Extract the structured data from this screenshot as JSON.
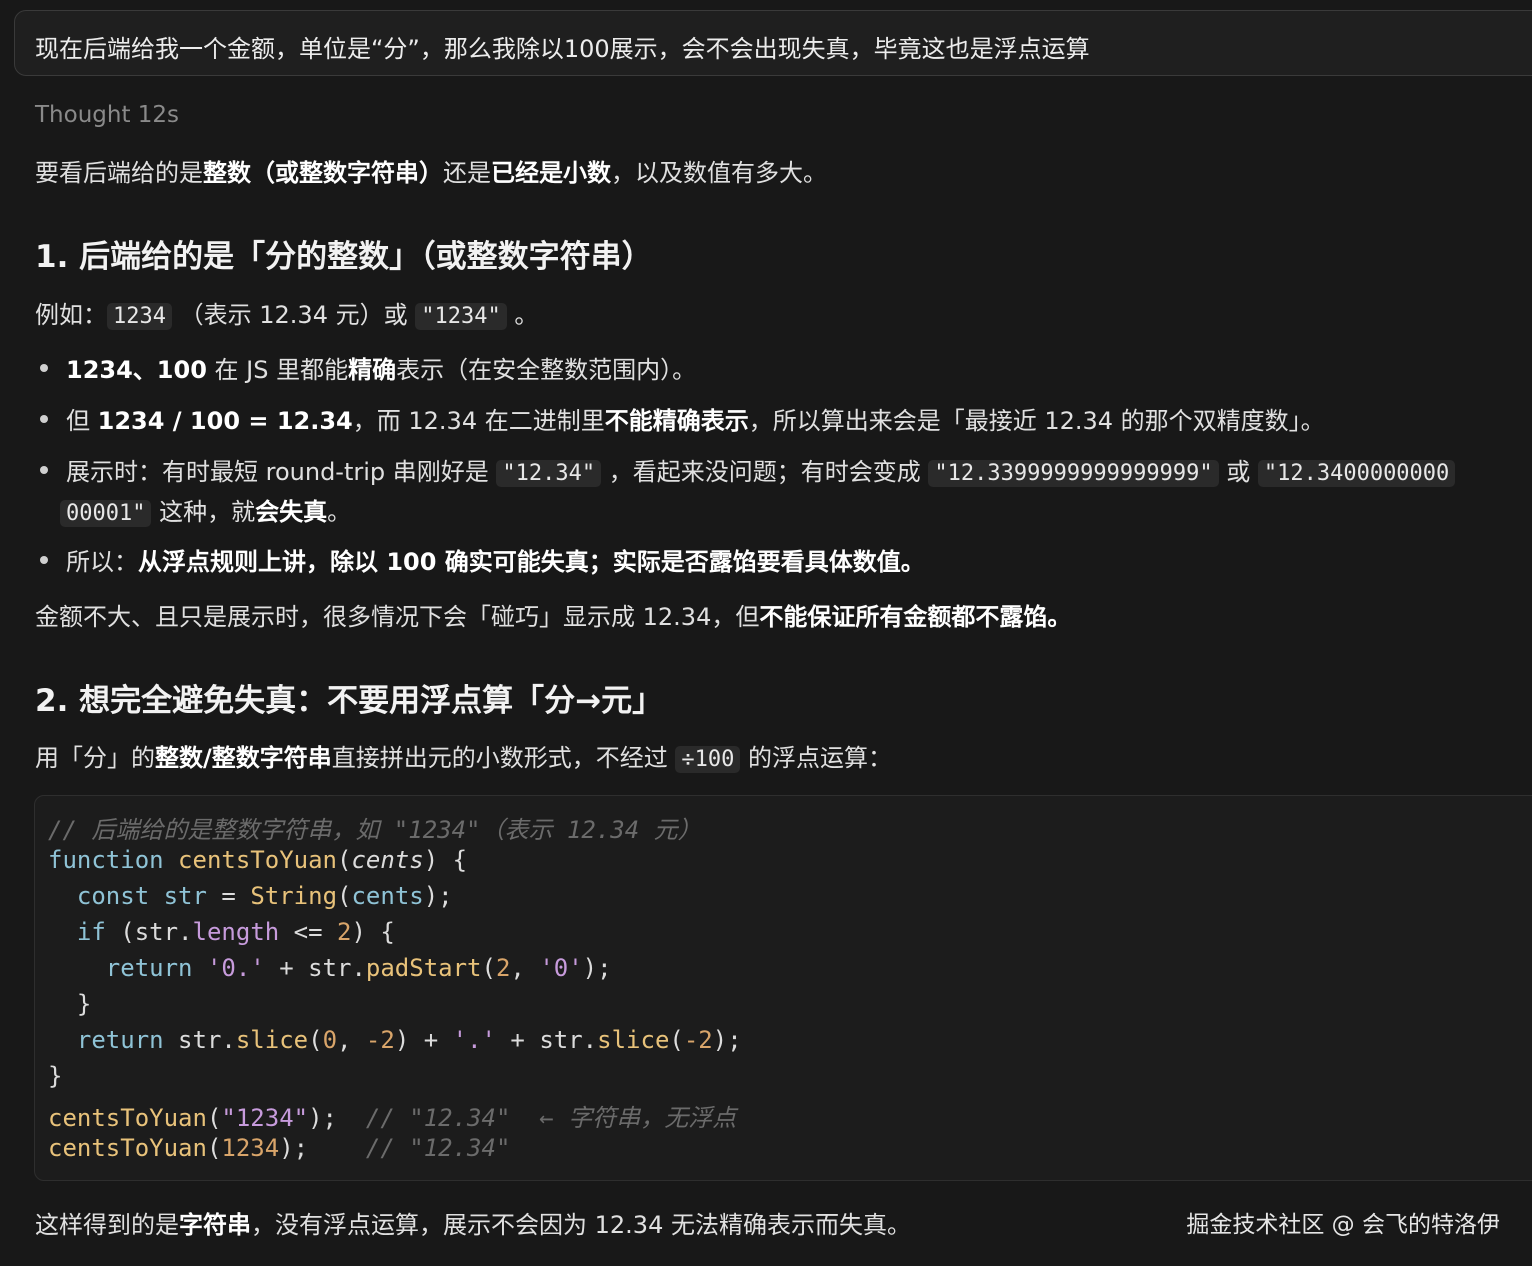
{
  "prompt": {
    "text": "现在后端给我一个金额，单位是“分”，那么我除以100展示，会不会出现失真，毕竟这也是浮点运算"
  },
  "thought": {
    "label": "Thought 12s"
  },
  "intro": {
    "p1": "要看后端给的是",
    "b1": "整数（或整数字符串）",
    "p2": "还是",
    "b2": "已经是小数",
    "p3": "，以及数值有多大。"
  },
  "section1": {
    "heading": "1. 后端给的是「分的整数」（或整数字符串）",
    "example": {
      "p1": "例如：",
      "code1": "1234",
      "p2": "（表示 12.34 元）或",
      "code2": "\"1234\"",
      "p3": "。"
    },
    "bullets": [
      {
        "b1": "1234、100",
        "p1": " 在 JS 里都能",
        "b2": "精确",
        "p2": "表示（在安全整数范围内）。"
      },
      {
        "p1": "但 ",
        "b1": "1234 / 100 = 12.34",
        "p2": "，而 12.34 在二进制里",
        "b2": "不能精确表示",
        "p3": "，所以算出来会是「最接近 12.34 的那个双精度数」。"
      },
      {
        "p1": "展示时：有时最短 round-trip 串刚好是",
        "code1": "\"12.34\"",
        "p2": "，看起来没问题；有时会变成",
        "code2": "\"12.3399999999999999\"",
        "p3": "或",
        "code3a": "\"12.3400000000",
        "code3b": "00001\"",
        "p4": "这种，就",
        "b1": "会失真",
        "p5": "。"
      },
      {
        "p1": "所以：",
        "b1": "从浮点规则上讲，除以 100 确实可能失真；实际是否露馅要看具体数值。"
      }
    ],
    "summary": {
      "p1": "金额不大、且只是展示时，很多情况下会「碰巧」显示成 12.34，但",
      "b1": "不能保证所有金额都不露馅。"
    }
  },
  "section2": {
    "heading": "2. 想完全避免失真：不要用浮点算「分→元」",
    "intro": {
      "p1": "用「分」的",
      "b1": "整数/整数字符串",
      "p2": "直接拼出元的小数形式，不经过",
      "code1": "÷100",
      "p3": "的浮点运算："
    },
    "code": {
      "comment": "// 后端给的是整数字符串，如 \"1234\"（表示 12.34 元）",
      "l2_kw": "function",
      "l2_fn": "centsToYuan",
      "l2_p1": "(",
      "l2_param": "cents",
      "l2_p2": ") {",
      "l3_kw": "const",
      "l3_var": "str",
      "l3_p1": " = ",
      "l3_fn": "String",
      "l3_p2": "(",
      "l3_arg": "cents",
      "l3_p3": ");",
      "l4_kw": "if",
      "l4_p1": " (str.",
      "l4_prop": "length",
      "l4_p2": " <= ",
      "l4_num": "2",
      "l4_p3": ") {",
      "l5_kw": "return",
      "l5_str1": "'0.'",
      "l5_p1": " + str.",
      "l5_fn": "padStart",
      "l5_p2": "(",
      "l5_num": "2",
      "l5_p3": ", ",
      "l5_str2": "'0'",
      "l5_p4": ");",
      "l6": "}",
      "l7_kw": "return",
      "l7_p1": " str.",
      "l7_fn1": "slice",
      "l7_p2": "(",
      "l7_num1": "0",
      "l7_p3": ", ",
      "l7_num2": "-2",
      "l7_p4": ") + ",
      "l7_str": "'.'",
      "l7_p5": " + str.",
      "l7_fn2": "slice",
      "l7_p6": "(",
      "l7_num3": "-2",
      "l7_p7": ");",
      "l8": "}",
      "l9_fn": "centsToYuan",
      "l9_p1": "(",
      "l9_str": "\"1234\"",
      "l9_p2": ");  ",
      "l9_comment": "// \"12.34\"  ← 字符串，无浮点",
      "l10_fn": "centsToYuan",
      "l10_p1": "(",
      "l10_num": "1234",
      "l10_p2": ");    ",
      "l10_comment": "// \"12.34\""
    },
    "conclusion": {
      "p1": "这样得到的是",
      "b1": "字符串",
      "p2": "，没有浮点运算，展示不会因为 12.34 无法精确表示而失真。"
    }
  },
  "watermark": {
    "text": "掘金技术社区 @ 会飞的特洛伊"
  }
}
